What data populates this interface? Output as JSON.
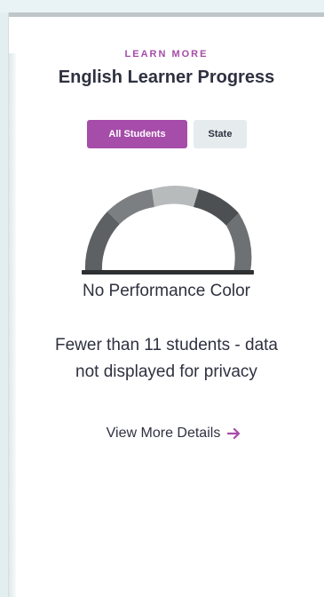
{
  "card": {
    "eyebrow": "LEARN MORE",
    "title": "English Learner Progress",
    "toggles": [
      {
        "label": "All Students",
        "active": true
      },
      {
        "label": "State",
        "active": false
      }
    ],
    "status": "No Performance Color",
    "privacy_note": {
      "line1": "Fewer than 11 students - data",
      "line2": "not displayed for privacy"
    },
    "details_link": "View More Details"
  },
  "icons": {
    "gauge": "performance-gauge-icon",
    "arrow": "arrow-right-icon"
  },
  "colors": {
    "accent": "#a64ca9",
    "gauge_dark": "#5e6163",
    "gauge_mid": "#7b7f82",
    "gauge_light": "#b8bbbc",
    "gauge_base": "#2e2f31"
  }
}
